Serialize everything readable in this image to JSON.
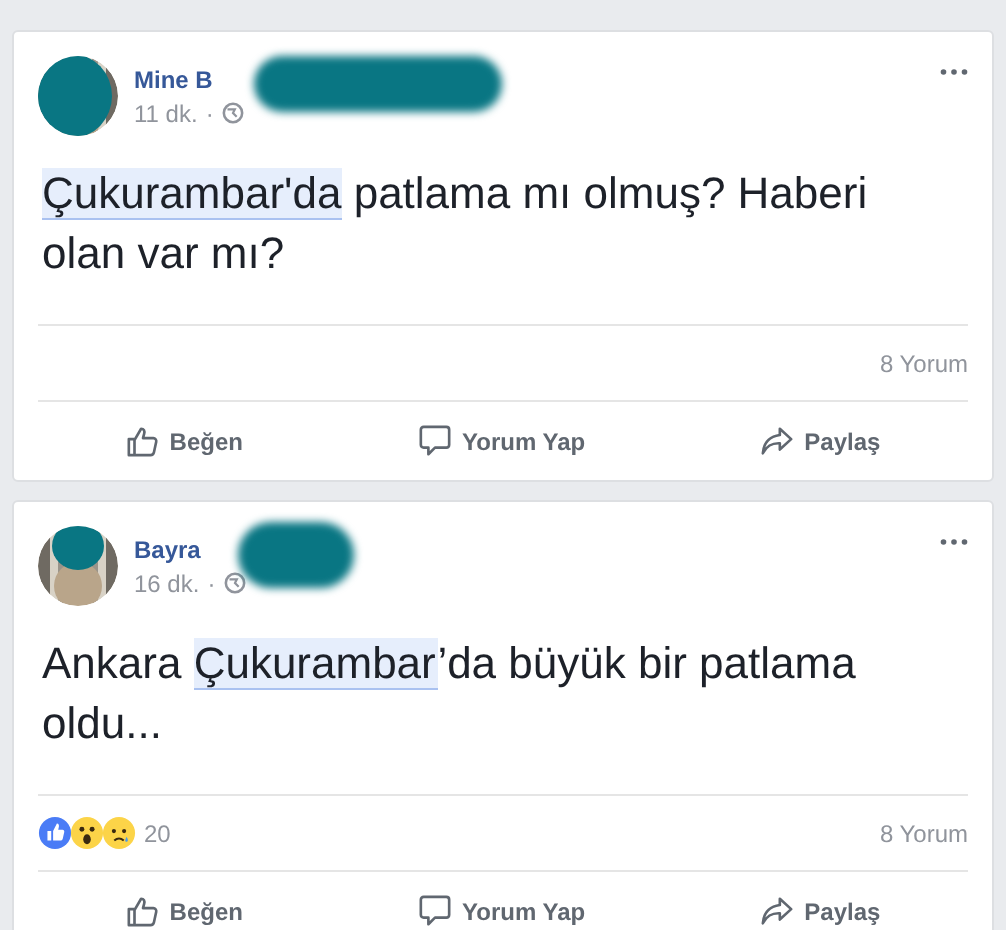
{
  "posts": [
    {
      "author": "Mine B",
      "time": "11 dk.",
      "separator": "·",
      "segments": [
        {
          "text": "Çukurambar'da",
          "highlighted": true
        },
        {
          "text": " patlama mı olmuş? Haberi olan var mı?",
          "highlighted": false
        }
      ],
      "comments": "8 Yorum",
      "actions": [
        {
          "kind": "like",
          "label": "Beğen"
        },
        {
          "kind": "comment",
          "label": "Yorum Yap"
        },
        {
          "kind": "share",
          "label": "Paylaş"
        }
      ]
    },
    {
      "author": "Bayra",
      "time": "16 dk.",
      "separator": "·",
      "segments": [
        {
          "text": "Ankara ",
          "highlighted": false
        },
        {
          "text": "Çukurambar",
          "highlighted": true
        },
        {
          "text": "’da büyük bir patlama oldu...",
          "highlighted": false
        }
      ],
      "reactions": [
        {
          "kind": "like"
        },
        {
          "kind": "wow"
        },
        {
          "kind": "sad"
        }
      ],
      "reaction_count": "20",
      "comments": "8 Yorum",
      "actions": [
        {
          "kind": "like",
          "label": "Beğen"
        },
        {
          "kind": "comment",
          "label": "Yorum Yap"
        },
        {
          "kind": "share",
          "label": "Paylaş"
        }
      ]
    }
  ]
}
